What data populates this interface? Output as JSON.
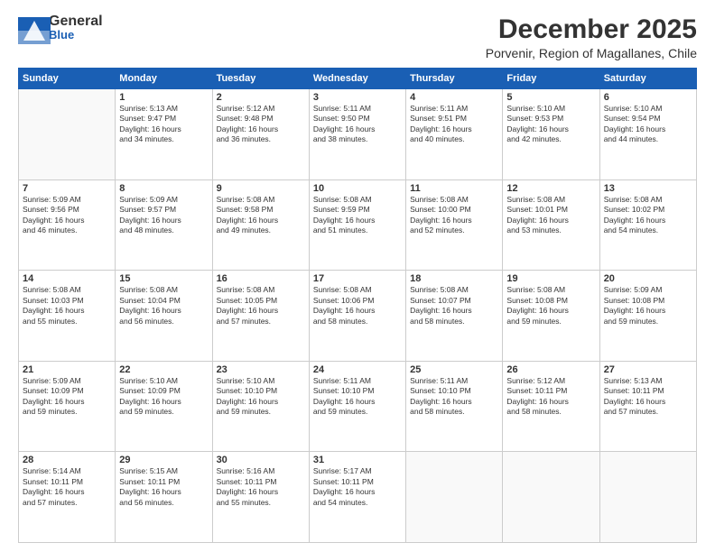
{
  "header": {
    "logo_general": "General",
    "logo_blue": "Blue",
    "month_title": "December 2025",
    "subtitle": "Porvenir, Region of Magallanes, Chile"
  },
  "days_of_week": [
    "Sunday",
    "Monday",
    "Tuesday",
    "Wednesday",
    "Thursday",
    "Friday",
    "Saturday"
  ],
  "weeks": [
    [
      {
        "day": "",
        "info": ""
      },
      {
        "day": "1",
        "info": "Sunrise: 5:13 AM\nSunset: 9:47 PM\nDaylight: 16 hours\nand 34 minutes."
      },
      {
        "day": "2",
        "info": "Sunrise: 5:12 AM\nSunset: 9:48 PM\nDaylight: 16 hours\nand 36 minutes."
      },
      {
        "day": "3",
        "info": "Sunrise: 5:11 AM\nSunset: 9:50 PM\nDaylight: 16 hours\nand 38 minutes."
      },
      {
        "day": "4",
        "info": "Sunrise: 5:11 AM\nSunset: 9:51 PM\nDaylight: 16 hours\nand 40 minutes."
      },
      {
        "day": "5",
        "info": "Sunrise: 5:10 AM\nSunset: 9:53 PM\nDaylight: 16 hours\nand 42 minutes."
      },
      {
        "day": "6",
        "info": "Sunrise: 5:10 AM\nSunset: 9:54 PM\nDaylight: 16 hours\nand 44 minutes."
      }
    ],
    [
      {
        "day": "7",
        "info": "Sunrise: 5:09 AM\nSunset: 9:56 PM\nDaylight: 16 hours\nand 46 minutes."
      },
      {
        "day": "8",
        "info": "Sunrise: 5:09 AM\nSunset: 9:57 PM\nDaylight: 16 hours\nand 48 minutes."
      },
      {
        "day": "9",
        "info": "Sunrise: 5:08 AM\nSunset: 9:58 PM\nDaylight: 16 hours\nand 49 minutes."
      },
      {
        "day": "10",
        "info": "Sunrise: 5:08 AM\nSunset: 9:59 PM\nDaylight: 16 hours\nand 51 minutes."
      },
      {
        "day": "11",
        "info": "Sunrise: 5:08 AM\nSunset: 10:00 PM\nDaylight: 16 hours\nand 52 minutes."
      },
      {
        "day": "12",
        "info": "Sunrise: 5:08 AM\nSunset: 10:01 PM\nDaylight: 16 hours\nand 53 minutes."
      },
      {
        "day": "13",
        "info": "Sunrise: 5:08 AM\nSunset: 10:02 PM\nDaylight: 16 hours\nand 54 minutes."
      }
    ],
    [
      {
        "day": "14",
        "info": "Sunrise: 5:08 AM\nSunset: 10:03 PM\nDaylight: 16 hours\nand 55 minutes."
      },
      {
        "day": "15",
        "info": "Sunrise: 5:08 AM\nSunset: 10:04 PM\nDaylight: 16 hours\nand 56 minutes."
      },
      {
        "day": "16",
        "info": "Sunrise: 5:08 AM\nSunset: 10:05 PM\nDaylight: 16 hours\nand 57 minutes."
      },
      {
        "day": "17",
        "info": "Sunrise: 5:08 AM\nSunset: 10:06 PM\nDaylight: 16 hours\nand 58 minutes."
      },
      {
        "day": "18",
        "info": "Sunrise: 5:08 AM\nSunset: 10:07 PM\nDaylight: 16 hours\nand 58 minutes."
      },
      {
        "day": "19",
        "info": "Sunrise: 5:08 AM\nSunset: 10:08 PM\nDaylight: 16 hours\nand 59 minutes."
      },
      {
        "day": "20",
        "info": "Sunrise: 5:09 AM\nSunset: 10:08 PM\nDaylight: 16 hours\nand 59 minutes."
      }
    ],
    [
      {
        "day": "21",
        "info": "Sunrise: 5:09 AM\nSunset: 10:09 PM\nDaylight: 16 hours\nand 59 minutes."
      },
      {
        "day": "22",
        "info": "Sunrise: 5:10 AM\nSunset: 10:09 PM\nDaylight: 16 hours\nand 59 minutes."
      },
      {
        "day": "23",
        "info": "Sunrise: 5:10 AM\nSunset: 10:10 PM\nDaylight: 16 hours\nand 59 minutes."
      },
      {
        "day": "24",
        "info": "Sunrise: 5:11 AM\nSunset: 10:10 PM\nDaylight: 16 hours\nand 59 minutes."
      },
      {
        "day": "25",
        "info": "Sunrise: 5:11 AM\nSunset: 10:10 PM\nDaylight: 16 hours\nand 58 minutes."
      },
      {
        "day": "26",
        "info": "Sunrise: 5:12 AM\nSunset: 10:11 PM\nDaylight: 16 hours\nand 58 minutes."
      },
      {
        "day": "27",
        "info": "Sunrise: 5:13 AM\nSunset: 10:11 PM\nDaylight: 16 hours\nand 57 minutes."
      }
    ],
    [
      {
        "day": "28",
        "info": "Sunrise: 5:14 AM\nSunset: 10:11 PM\nDaylight: 16 hours\nand 57 minutes."
      },
      {
        "day": "29",
        "info": "Sunrise: 5:15 AM\nSunset: 10:11 PM\nDaylight: 16 hours\nand 56 minutes."
      },
      {
        "day": "30",
        "info": "Sunrise: 5:16 AM\nSunset: 10:11 PM\nDaylight: 16 hours\nand 55 minutes."
      },
      {
        "day": "31",
        "info": "Sunrise: 5:17 AM\nSunset: 10:11 PM\nDaylight: 16 hours\nand 54 minutes."
      },
      {
        "day": "",
        "info": ""
      },
      {
        "day": "",
        "info": ""
      },
      {
        "day": "",
        "info": ""
      }
    ]
  ]
}
